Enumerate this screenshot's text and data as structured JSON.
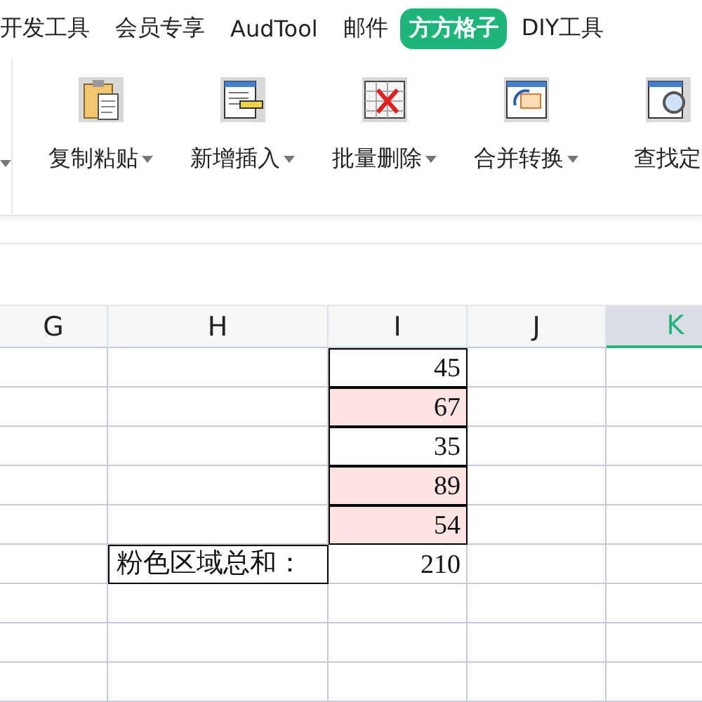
{
  "menu_tabs": [
    {
      "label": "开发工具",
      "selected": false
    },
    {
      "label": "会员专享",
      "selected": false
    },
    {
      "label": "AudTool",
      "selected": false
    },
    {
      "label": "邮件",
      "selected": false
    },
    {
      "label": "方方格子",
      "selected": true
    },
    {
      "label": "DIY工具",
      "selected": false
    }
  ],
  "ribbon": {
    "buttons": [
      {
        "label": "复制粘贴",
        "dropdown": true
      },
      {
        "label": "新增插入",
        "dropdown": true
      },
      {
        "label": "批量删除",
        "dropdown": true
      },
      {
        "label": "合并转换",
        "dropdown": true
      },
      {
        "label": "查找定",
        "dropdown": false
      }
    ]
  },
  "sheet": {
    "columns": [
      {
        "label": "G",
        "selected": false
      },
      {
        "label": "H",
        "selected": false
      },
      {
        "label": "I",
        "selected": false
      },
      {
        "label": "J",
        "selected": false
      },
      {
        "label": "K",
        "selected": true
      }
    ],
    "rows": [
      [
        {},
        {},
        {
          "text": "45",
          "boxed": true,
          "highlighted": false
        },
        {},
        {}
      ],
      [
        {},
        {},
        {
          "text": "67",
          "boxed": true,
          "highlighted": true
        },
        {},
        {}
      ],
      [
        {},
        {},
        {
          "text": "35",
          "boxed": true,
          "highlighted": false
        },
        {},
        {}
      ],
      [
        {},
        {},
        {
          "text": "89",
          "boxed": true,
          "highlighted": true
        },
        {},
        {}
      ],
      [
        {},
        {},
        {
          "text": "54",
          "boxed": true,
          "highlighted": true
        },
        {},
        {}
      ],
      [
        {},
        {
          "text": "粉色区域总和：",
          "boxed": true,
          "highlighted": false
        },
        {
          "text": "210",
          "boxed": false,
          "highlighted": false
        },
        {},
        {}
      ],
      [
        {},
        {},
        {},
        {},
        {}
      ],
      [
        {},
        {},
        {},
        {},
        {}
      ],
      [
        {},
        {},
        {},
        {},
        {}
      ]
    ]
  }
}
